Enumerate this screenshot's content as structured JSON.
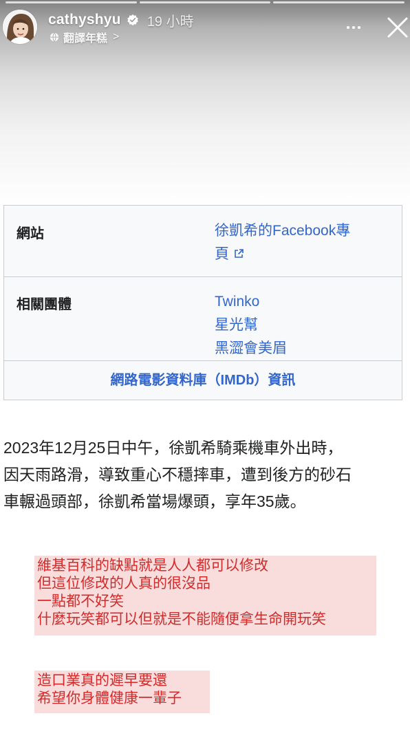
{
  "story": {
    "username": "cathyshyu",
    "time": "19 小時",
    "translate_label": "翻譯年糕",
    "translate_chevron": ">"
  },
  "infobox": {
    "website_label": "網站",
    "website_value_line1": "徐凱希的Facebook專",
    "website_value_line2": "頁",
    "groups_label": "相關團體",
    "groups": [
      "Twinko",
      "星光幫",
      "黑澀會美眉"
    ],
    "imdb_link": "網路電影資料庫（IMDb）資訊"
  },
  "article": {
    "lines": [
      "2023年12月25日中午，徐凱希騎乘機車外出時，",
      "因天雨路滑，導致重心不穩摔車，遭到後方的砂石",
      "車輾過頭部，徐凱希當場爆頭，享年35歲。"
    ]
  },
  "notes": {
    "first": [
      "維基百科的缺點就是人人都可以修改",
      "但這位修改的人真的很沒品",
      "一點都不好笑",
      "什麼玩笑都可以但就是不能隨便拿生命開玩笑"
    ],
    "second": [
      "造口業真的遲早要還",
      "希望你身體健康一輩子"
    ]
  },
  "icons": {
    "verified": "verified-badge-icon",
    "translate": "globe-icon",
    "more": "more-options-icon",
    "close": "close-icon",
    "external_link": "external-link-icon"
  },
  "colors": {
    "link": "#3366cc",
    "note_text": "#d32a2a",
    "note_highlight": "#f7d0d0",
    "infobox_bg": "#f8f9fa"
  }
}
